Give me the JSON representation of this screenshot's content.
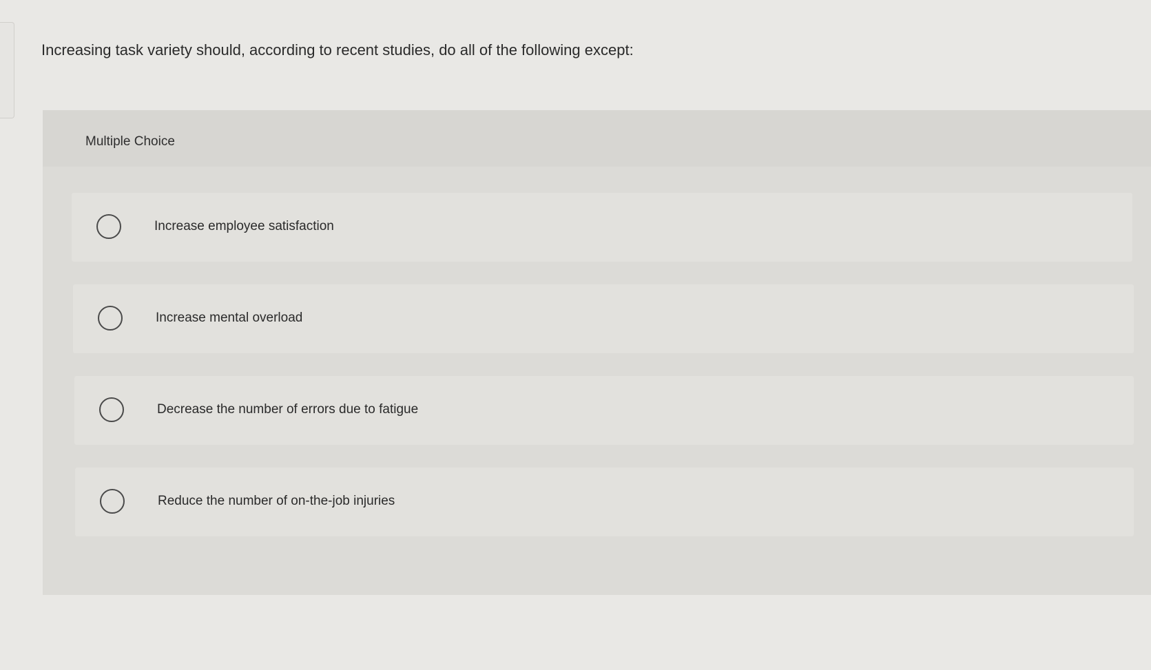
{
  "question": {
    "text": "Increasing task variety should, according to recent studies, do all of the following except:"
  },
  "multiple_choice": {
    "label": "Multiple Choice",
    "options": [
      {
        "label": "Increase employee satisfaction"
      },
      {
        "label": "Increase mental overload"
      },
      {
        "label": "Decrease the number of errors due to fatigue"
      },
      {
        "label": "Reduce the number of on-the-job injuries"
      }
    ]
  }
}
